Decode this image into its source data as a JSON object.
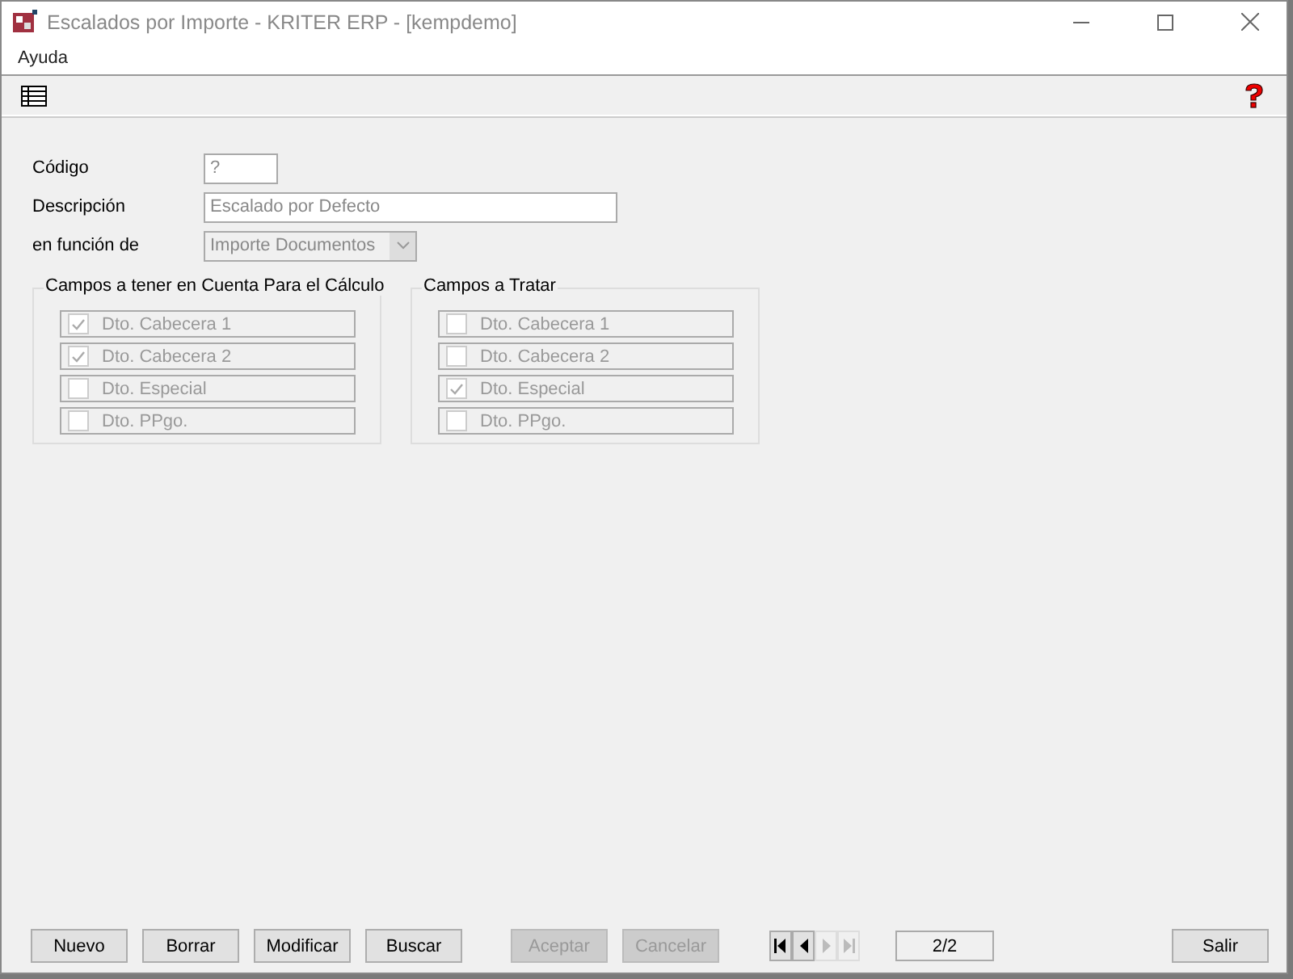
{
  "window": {
    "title": "Escalados por Importe - KRITER ERP - [kempdemo]"
  },
  "menu": [
    "Ayuda"
  ],
  "form": {
    "fields": [
      {
        "label": "Código",
        "value": "?",
        "kind": "short"
      },
      {
        "label": "Descripción",
        "value": "Escalado por Defecto",
        "kind": "long"
      },
      {
        "label": "en función de",
        "value": "Importe Documentos",
        "kind": "combo"
      }
    ]
  },
  "groups": [
    {
      "title": "Campos a tener en Cuenta Para el Cálculo",
      "items": [
        {
          "label": "Dto. Cabecera 1",
          "checked": true
        },
        {
          "label": "Dto. Cabecera 2",
          "checked": true
        },
        {
          "label": "Dto. Especial",
          "checked": false
        },
        {
          "label": "Dto. PPgo.",
          "checked": false
        }
      ]
    },
    {
      "title": "Campos a Tratar",
      "items": [
        {
          "label": "Dto. Cabecera 1",
          "checked": false
        },
        {
          "label": "Dto. Cabecera 2",
          "checked": false
        },
        {
          "label": "Dto. Especial",
          "checked": true
        },
        {
          "label": "Dto. PPgo.",
          "checked": false
        }
      ]
    }
  ],
  "buttons": [
    {
      "label": "Nuevo",
      "disabled": false
    },
    {
      "label": "Borrar",
      "disabled": false
    },
    {
      "label": "Modificar",
      "disabled": false
    },
    {
      "label": "Buscar",
      "disabled": false
    },
    {
      "label": "Aceptar",
      "disabled": true
    },
    {
      "label": "Cancelar",
      "disabled": true
    }
  ],
  "navigator": [
    {
      "kind": "first",
      "disabled": false
    },
    {
      "kind": "prev",
      "disabled": false
    },
    {
      "kind": "next",
      "disabled": true
    },
    {
      "kind": "last",
      "disabled": true
    }
  ],
  "record_counter": "2/2",
  "exit_button": {
    "label": "Salir",
    "disabled": false
  }
}
